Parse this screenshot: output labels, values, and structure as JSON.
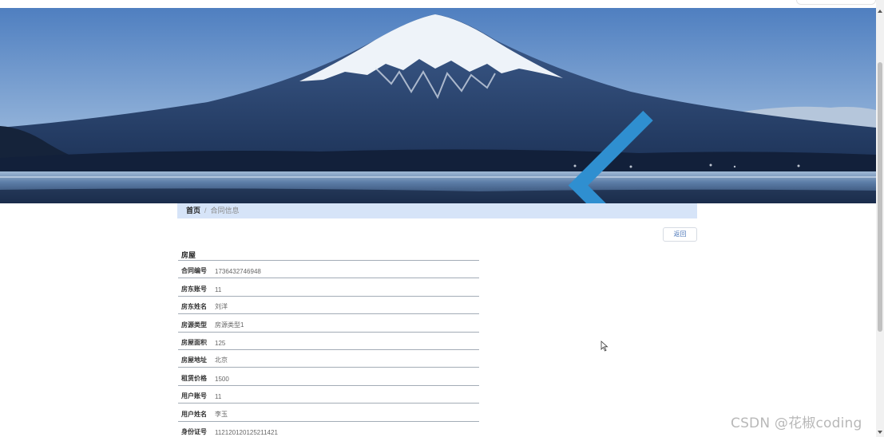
{
  "breadcrumb": {
    "home": "首页",
    "separator": "/",
    "current": "合同信息"
  },
  "actions": {
    "back_label": "返回"
  },
  "detail": {
    "section_title": "房屋",
    "rows": [
      {
        "label": "合同编号",
        "value": "1736432746948"
      },
      {
        "label": "房东账号",
        "value": "11"
      },
      {
        "label": "房东姓名",
        "value": "刘洋"
      },
      {
        "label": "房源类型",
        "value": "房源类型1"
      },
      {
        "label": "房屋面积",
        "value": "125"
      },
      {
        "label": "房屋地址",
        "value": "北京"
      },
      {
        "label": "租赁价格",
        "value": "1500"
      },
      {
        "label": "用户账号",
        "value": "11"
      },
      {
        "label": "用户姓名",
        "value": "李玉"
      },
      {
        "label": "身份证号",
        "value": "112120120125211421"
      }
    ]
  },
  "carousel": {
    "prev_icon": "chevron-left-icon",
    "next_icon": "chevron-right-icon"
  },
  "watermark": "CSDN @花椒coding",
  "colors": {
    "breadcrumb_bg": "#d6e4f8",
    "link_blue": "#4a76b8",
    "row_border": "#a3acb6"
  }
}
